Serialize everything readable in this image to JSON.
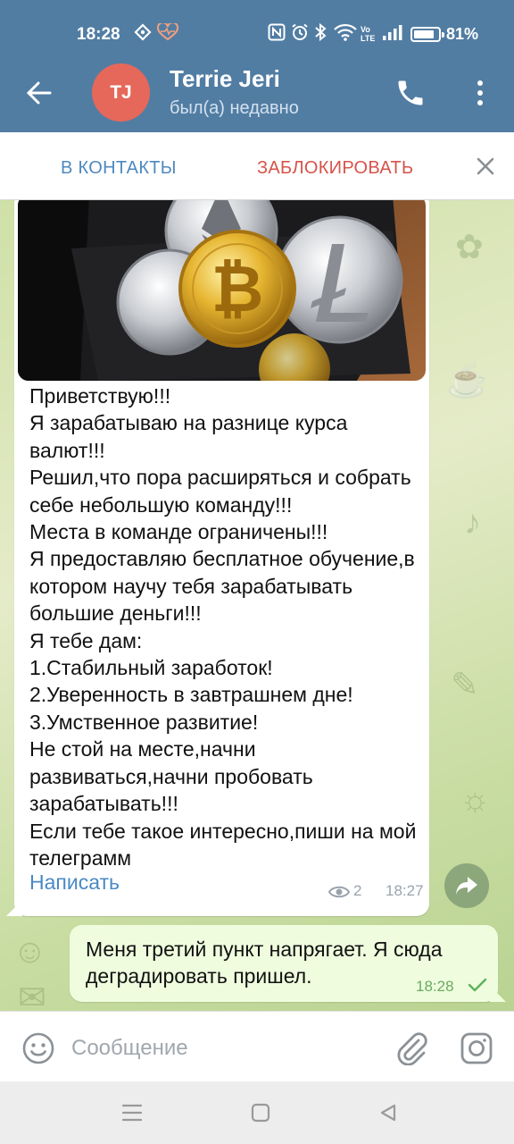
{
  "status_bar": {
    "time": "18:28",
    "battery_level": 0.81,
    "battery_text": "81%",
    "icons": [
      "nav-diamond-icon",
      "heartbeat-icon",
      "nfc-icon",
      "alarm-icon",
      "bluetooth-icon",
      "wifi-icon",
      "volte-icon",
      "signal-icon",
      "battery-icon"
    ]
  },
  "header": {
    "avatar_initials": "TJ",
    "avatar_color": "#e5685a",
    "contact_name": "Terrie Jeri",
    "last_seen": "был(а) недавно",
    "bar_color": "#527da3"
  },
  "action_bar": {
    "add_contact_label": "В КОНТАКТЫ",
    "block_label": "ЗАБЛОКИРОВАТЬ"
  },
  "messages": [
    {
      "direction": "incoming",
      "has_photo": true,
      "text": "Приветствую!!!\nЯ зарабатываю на разнице курса валют!!!\nРешил,что пора расширяться и собрать себе небольшую команду!!!\nМеста в команде ограничены!!!\nЯ предоставляю бесплатное обучение,в котором научу тебя зарабатывать большие деньги!!!\nЯ тебе дам:\n1.Стабильный заработок!\n2.Уверенность в завтрашнем дне!\n3.Умственное развитие!\nНе стой на месте,начни развиваться,начни пробовать зарабатывать!!!\nЕсли тебе такое интересно,пиши на мой телеграмм",
      "link_text": "Написать",
      "views": "2",
      "time": "18:27"
    },
    {
      "direction": "outgoing",
      "text": "Меня третий пункт напрягает. Я сюда деградировать пришел.",
      "time": "18:28",
      "status": "sent"
    }
  ],
  "composer": {
    "placeholder": "Сообщение"
  },
  "colors": {
    "incoming_bubble": "#ffffff",
    "outgoing_bubble": "#effdde",
    "link": "#4a89c6",
    "block_red": "#d7534a",
    "add_blue": "#4f89bf"
  }
}
